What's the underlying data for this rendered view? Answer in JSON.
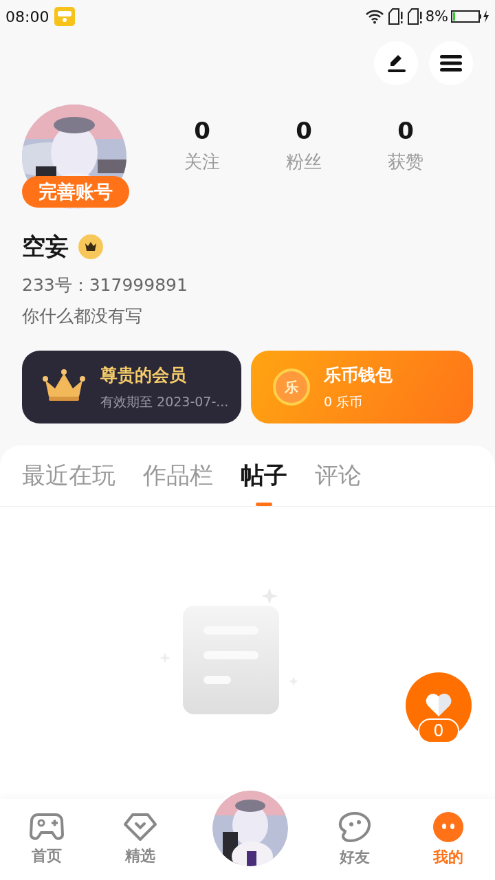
{
  "status_bar": {
    "time": "08:00",
    "battery": "8%"
  },
  "profile": {
    "complete_button": "完善账号",
    "name": "空妄",
    "id_line": "233号：317999891",
    "bio": "你什么都没有写",
    "stats": [
      {
        "value": "0",
        "label": "关注"
      },
      {
        "value": "0",
        "label": "粉丝"
      },
      {
        "value": "0",
        "label": "获赞"
      }
    ]
  },
  "cards": [
    {
      "kind": "member",
      "title": "尊贵的会员",
      "subtitle": "有效期至 2023-07-..."
    },
    {
      "kind": "wallet",
      "title": "乐币钱包",
      "subtitle": "0 乐币",
      "coin": "乐"
    }
  ],
  "tabs": [
    {
      "label": "最近在玩",
      "selected": false
    },
    {
      "label": "作品栏",
      "selected": false
    },
    {
      "label": "帖子",
      "selected": true
    },
    {
      "label": "评论",
      "selected": false
    }
  ],
  "like_badge": {
    "count": "0"
  },
  "bottom_nav": [
    {
      "kind": "game",
      "label": "首页",
      "selected": false
    },
    {
      "kind": "heart",
      "label": "精选",
      "selected": false
    },
    {
      "kind": "avatar"
    },
    {
      "kind": "friend",
      "label": "好友",
      "selected": false
    },
    {
      "kind": "me",
      "label": "我的",
      "selected": true
    }
  ]
}
